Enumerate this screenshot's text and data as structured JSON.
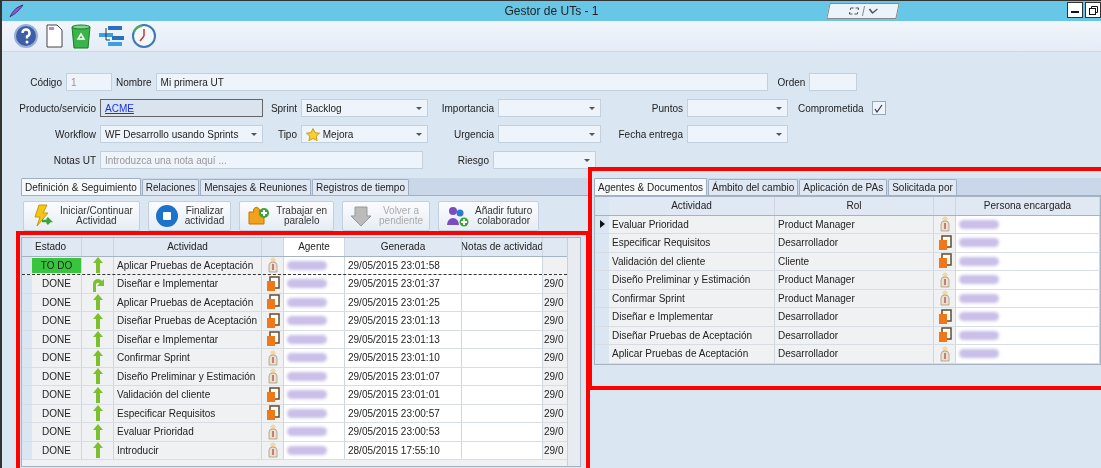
{
  "window": {
    "title": "Gestor de UTs - 1"
  },
  "form": {
    "codigo": {
      "label": "Código",
      "value": "1"
    },
    "nombre": {
      "label": "Nombre",
      "value": "Mi primera UT"
    },
    "orden": {
      "label": "Orden"
    },
    "producto": {
      "label": "Producto/servicio",
      "value": "ACME"
    },
    "sprint": {
      "label": "Sprint",
      "value": "Backlog"
    },
    "importancia": {
      "label": "Importancia"
    },
    "puntos": {
      "label": "Puntos"
    },
    "comprometida": {
      "label": "Comprometida",
      "checked": true
    },
    "workflow": {
      "label": "Workflow",
      "value": "WF Desarrollo usando Sprints"
    },
    "tipo": {
      "label": "Tipo",
      "value": "Mejora"
    },
    "urgencia": {
      "label": "Urgencia"
    },
    "fecha_entrega": {
      "label": "Fecha entrega"
    },
    "notas": {
      "label": "Notas UT",
      "placeholder": "Introduzca una nota aquí ..."
    },
    "riesgo": {
      "label": "Riesgo"
    }
  },
  "left_tabs": [
    {
      "label": "Definición & Seguimiento",
      "selected": true
    },
    {
      "label": "Relaciones",
      "selected": false
    },
    {
      "label": "Mensajes & Reuniones",
      "selected": false
    },
    {
      "label": "Registros de tiempo",
      "selected": false
    }
  ],
  "actions": [
    {
      "kind": "start",
      "lines": [
        "Iniciar/Continuar",
        "Actividad"
      ],
      "disabled": false
    },
    {
      "kind": "stop",
      "lines": [
        "Finalizar",
        "actividad"
      ],
      "disabled": false
    },
    {
      "kind": "parallel",
      "lines": [
        "Trabajar en",
        "paralelo"
      ],
      "disabled": false
    },
    {
      "kind": "back",
      "lines": [
        "Volver a",
        "pendiente"
      ],
      "disabled": true
    },
    {
      "kind": "collab",
      "lines": [
        "Añadir futuro",
        "colaborador"
      ],
      "disabled": false
    }
  ],
  "activities": {
    "columns": [
      "Estado",
      "Actividad",
      "Agente",
      "Generada",
      "Notas de actividad"
    ],
    "rows": [
      {
        "status": "TO DO",
        "selected": true,
        "arrow": {
          "kind": "up"
        },
        "activity": "Aplicar Pruebas de Aceptación",
        "agent": {
          "kind": "person"
        },
        "generated": "29/05/2015 23:01:58"
      },
      {
        "status": "DONE",
        "selected": false,
        "arrow": {
          "kind": "turn"
        },
        "activity": "Diseñar e Implementar",
        "agent": {
          "kind": "role"
        },
        "generated": "29/05/2015 23:01:37",
        "column_8": "29/0"
      },
      {
        "status": "DONE",
        "selected": false,
        "arrow": {
          "kind": "up"
        },
        "activity": "Aplicar Pruebas de Aceptación",
        "agent": {
          "kind": "role"
        },
        "generated": "29/05/2015 23:01:25",
        "column_8": "29/0"
      },
      {
        "status": "DONE",
        "selected": false,
        "arrow": {
          "kind": "up"
        },
        "activity": "Diseñar Pruebas de Aceptación",
        "agent": {
          "kind": "role"
        },
        "generated": "29/05/2015 23:01:13",
        "column_8": "29/0"
      },
      {
        "status": "DONE",
        "selected": false,
        "arrow": {
          "kind": "up"
        },
        "activity": "Diseñar e Implementar",
        "agent": {
          "kind": "role"
        },
        "generated": "29/05/2015 23:01:13",
        "column_8": "29/0"
      },
      {
        "status": "DONE",
        "selected": false,
        "arrow": {
          "kind": "up"
        },
        "activity": "Confirmar Sprint",
        "agent": {
          "kind": "person"
        },
        "generated": "29/05/2015 23:01:10",
        "column_8": "29/0"
      },
      {
        "status": "DONE",
        "selected": false,
        "arrow": {
          "kind": "up"
        },
        "activity": "Diseño Preliminar y Estimación",
        "agent": {
          "kind": "person"
        },
        "generated": "29/05/2015 23:01:07",
        "column_8": "29/0"
      },
      {
        "status": "DONE",
        "selected": false,
        "arrow": {
          "kind": "up"
        },
        "activity": "Validación del cliente",
        "agent": {
          "kind": "role"
        },
        "generated": "29/05/2015 23:01:01",
        "column_8": "29/0"
      },
      {
        "status": "DONE",
        "selected": false,
        "arrow": {
          "kind": "up"
        },
        "activity": "Especificar Requisitos",
        "agent": {
          "kind": "role"
        },
        "generated": "29/05/2015 23:00:57",
        "column_8": "29/0"
      },
      {
        "status": "DONE",
        "selected": false,
        "arrow": {
          "kind": "up"
        },
        "activity": "Evaluar Prioridad",
        "agent": {
          "kind": "person"
        },
        "generated": "29/05/2015 23:00:53",
        "column_8": "29/0"
      },
      {
        "status": "DONE",
        "selected": false,
        "arrow": {
          "kind": "up"
        },
        "activity": "Introducir",
        "agent": {
          "kind": "person"
        },
        "generated": "28/05/2015 17:55:10",
        "column_8": "29/0"
      }
    ]
  },
  "right_tabs": [
    {
      "label": "Agentes & Documentos",
      "selected": true
    },
    {
      "label": "Ámbito del cambio",
      "selected": false
    },
    {
      "label": "Aplicación de PAs",
      "selected": false
    },
    {
      "label": "Solicitada por",
      "selected": false
    }
  ],
  "assignments": {
    "columns": [
      "Actividad",
      "Rol",
      "Persona encargada"
    ],
    "rows": [
      {
        "activity": "Evaluar Prioridad",
        "role": "Product Manager",
        "agent": {
          "kind": "person"
        },
        "selected": true
      },
      {
        "activity": "Especificar Requisitos",
        "role": "Desarrollador",
        "agent": {
          "kind": "role"
        },
        "selected": false
      },
      {
        "activity": "Validación del cliente",
        "role": "Cliente",
        "agent": {
          "kind": "role"
        },
        "selected": false
      },
      {
        "activity": "Diseño Preliminar y Estimación",
        "role": "Product Manager",
        "agent": {
          "kind": "person"
        },
        "selected": false
      },
      {
        "activity": "Confirmar Sprint",
        "role": "Product Manager",
        "agent": {
          "kind": "person"
        },
        "selected": false
      },
      {
        "activity": "Diseñar e Implementar",
        "role": "Desarrollador",
        "agent": {
          "kind": "role"
        },
        "selected": false
      },
      {
        "activity": "Diseñar Pruebas de Aceptación",
        "role": "Desarrollador",
        "agent": {
          "kind": "role"
        },
        "selected": false
      },
      {
        "activity": "Aplicar Pruebas de Aceptación",
        "role": "Desarrollador",
        "agent": {
          "kind": "person"
        },
        "selected": false
      }
    ]
  }
}
